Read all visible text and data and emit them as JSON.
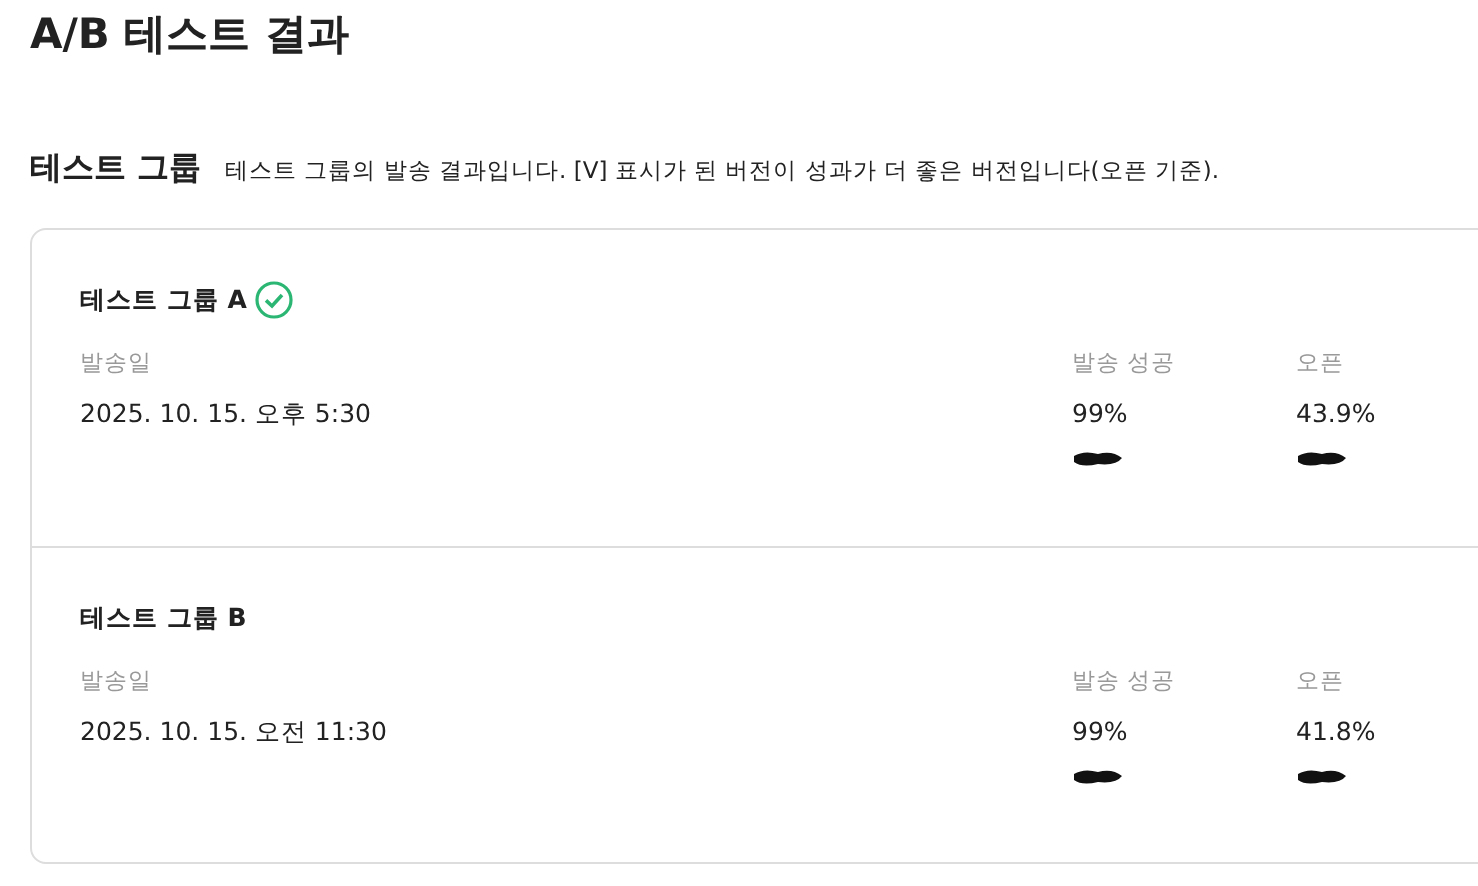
{
  "page_title": "A/B 테스트 결과",
  "section": {
    "title": "테스트 그룹",
    "description": "테스트 그룹의 발송 결과입니다. [V] 표시가 된 버전이 성과가 더 좋은 버전입니다(오픈 기준)."
  },
  "groups": [
    {
      "name": "테스트 그룹 A",
      "winner": true,
      "date_label": "발송일",
      "date": "2025. 10. 15. 오후 5:30",
      "success_label": "발송 성공",
      "success": "99%",
      "open_label": "오픈",
      "open": "43.9%"
    },
    {
      "name": "테스트 그룹 B",
      "winner": false,
      "date_label": "발송일",
      "date": "2025. 10. 15. 오전 11:30",
      "success_label": "발송 성공",
      "success": "99%",
      "open_label": "오픈",
      "open": "41.8%"
    }
  ]
}
